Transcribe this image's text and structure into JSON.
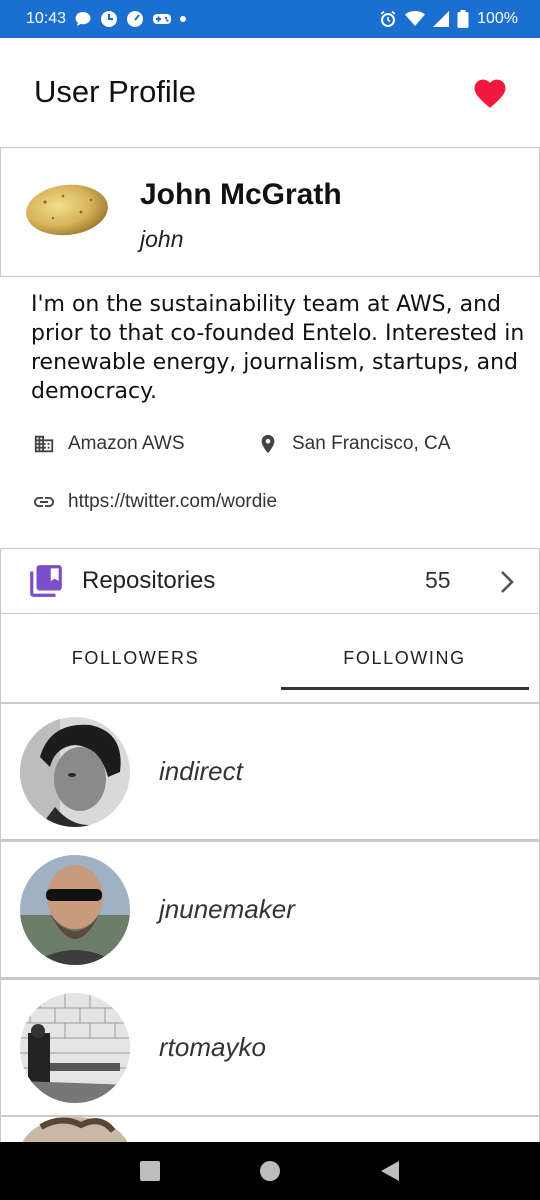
{
  "status_bar": {
    "time": "10:43",
    "battery": "100%",
    "background_color": "#1a6fd1",
    "left_icons": [
      "chat-bubble-icon",
      "app-badge-icon",
      "speed-icon",
      "gamepad-icon",
      "notification-dot-icon"
    ],
    "right_icons": [
      "alarm-icon",
      "wifi-icon",
      "signal-icon",
      "battery-icon"
    ]
  },
  "header": {
    "title": "User Profile",
    "favorite_icon": "heart-icon",
    "favorite_color": "#f0183c"
  },
  "profile": {
    "full_name": "John McGrath",
    "username": "john",
    "avatar": "potato-avatar"
  },
  "bio": {
    "text": "I'm on the sustainability team at AWS, and prior to that co-founded Entelo. Interested in renewable energy, journalism, startups, and democracy.",
    "company": "Amazon AWS",
    "location": "San Francisco, CA",
    "website": "https://twitter.com/wordie"
  },
  "repositories": {
    "label": "Repositories",
    "count": "55",
    "icon_color": "#7b4fc9"
  },
  "tabs": [
    {
      "label": "FOLLOWERS",
      "selected": false
    },
    {
      "label": "FOLLOWING",
      "selected": true
    }
  ],
  "following": [
    {
      "login": "indirect"
    },
    {
      "login": "jnunemaker"
    },
    {
      "login": "rtomayko"
    }
  ],
  "nav_bar": {
    "buttons": [
      "recents-square-icon",
      "home-circle-icon",
      "back-triangle-icon"
    ]
  }
}
